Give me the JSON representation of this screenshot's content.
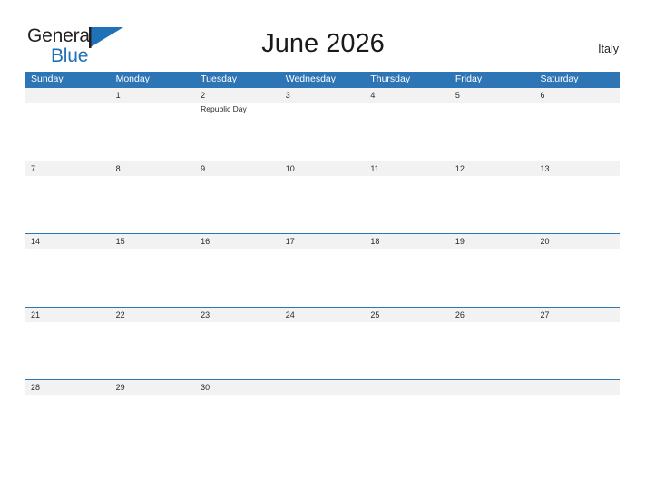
{
  "brand": {
    "word_one": "General",
    "word_two": "Blue",
    "flag_icon": "blue-flag-triangle-icon",
    "accent_color": "#2072b8"
  },
  "header": {
    "title": "June 2026",
    "country": "Italy"
  },
  "colors": {
    "header_blue": "#2e75b6",
    "row_gray": "#f2f2f2",
    "text_dark": "#2a2a2a",
    "page_background": "#ffffff"
  },
  "calendar": {
    "month": "June",
    "year": "2026",
    "weekdays": [
      "Sunday",
      "Monday",
      "Tuesday",
      "Wednesday",
      "Thursday",
      "Friday",
      "Saturday"
    ],
    "weeks": [
      {
        "days": [
          {
            "date": "",
            "event": ""
          },
          {
            "date": "1",
            "event": ""
          },
          {
            "date": "2",
            "event": "Republic Day"
          },
          {
            "date": "3",
            "event": ""
          },
          {
            "date": "4",
            "event": ""
          },
          {
            "date": "5",
            "event": ""
          },
          {
            "date": "6",
            "event": ""
          }
        ]
      },
      {
        "days": [
          {
            "date": "7",
            "event": ""
          },
          {
            "date": "8",
            "event": ""
          },
          {
            "date": "9",
            "event": ""
          },
          {
            "date": "10",
            "event": ""
          },
          {
            "date": "11",
            "event": ""
          },
          {
            "date": "12",
            "event": ""
          },
          {
            "date": "13",
            "event": ""
          }
        ]
      },
      {
        "days": [
          {
            "date": "14",
            "event": ""
          },
          {
            "date": "15",
            "event": ""
          },
          {
            "date": "16",
            "event": ""
          },
          {
            "date": "17",
            "event": ""
          },
          {
            "date": "18",
            "event": ""
          },
          {
            "date": "19",
            "event": ""
          },
          {
            "date": "20",
            "event": ""
          }
        ]
      },
      {
        "days": [
          {
            "date": "21",
            "event": ""
          },
          {
            "date": "22",
            "event": ""
          },
          {
            "date": "23",
            "event": ""
          },
          {
            "date": "24",
            "event": ""
          },
          {
            "date": "25",
            "event": ""
          },
          {
            "date": "26",
            "event": ""
          },
          {
            "date": "27",
            "event": ""
          }
        ]
      },
      {
        "days": [
          {
            "date": "28",
            "event": ""
          },
          {
            "date": "29",
            "event": ""
          },
          {
            "date": "30",
            "event": ""
          },
          {
            "date": "",
            "event": ""
          },
          {
            "date": "",
            "event": ""
          },
          {
            "date": "",
            "event": ""
          },
          {
            "date": "",
            "event": ""
          }
        ]
      }
    ]
  }
}
